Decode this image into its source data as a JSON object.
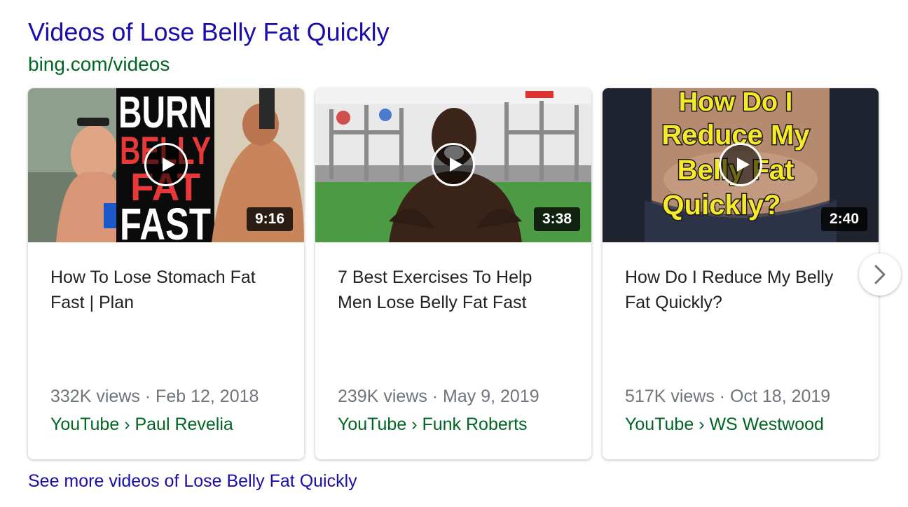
{
  "header": {
    "title": "Videos of Lose Belly Fat Quickly",
    "source": "bing.com/videos"
  },
  "cards": [
    {
      "title": "How To Lose Stomach Fat Fast | Plan",
      "duration": "9:16",
      "meta": "332K views · Feb 12, 2018",
      "channel": "YouTube › Paul Revelia",
      "thumb_text": [
        "BURN",
        "BELLY",
        "FAT",
        "FAST"
      ]
    },
    {
      "title": "7 Best Exercises To Help Men Lose Belly Fat Fast",
      "duration": "3:38",
      "meta": "239K views · May 9, 2019",
      "channel": "YouTube › Funk Roberts"
    },
    {
      "title": "How Do I Reduce My Belly Fat Quickly?",
      "duration": "2:40",
      "meta": "517K views · Oct 18, 2019",
      "channel": "YouTube › WS Westwood",
      "thumb_text": [
        "How Do I",
        "Reduce My",
        "Belly Fat",
        "Quickly?"
      ]
    }
  ],
  "footer": {
    "see_more": "See more videos of Lose Belly Fat Quickly"
  },
  "colors": {
    "link": "#1a0dab",
    "url_green": "#006621",
    "meta_gray": "#70757a",
    "title_text": "#222222"
  },
  "icons": {
    "play": "play-icon",
    "next": "chevron-right-icon"
  }
}
